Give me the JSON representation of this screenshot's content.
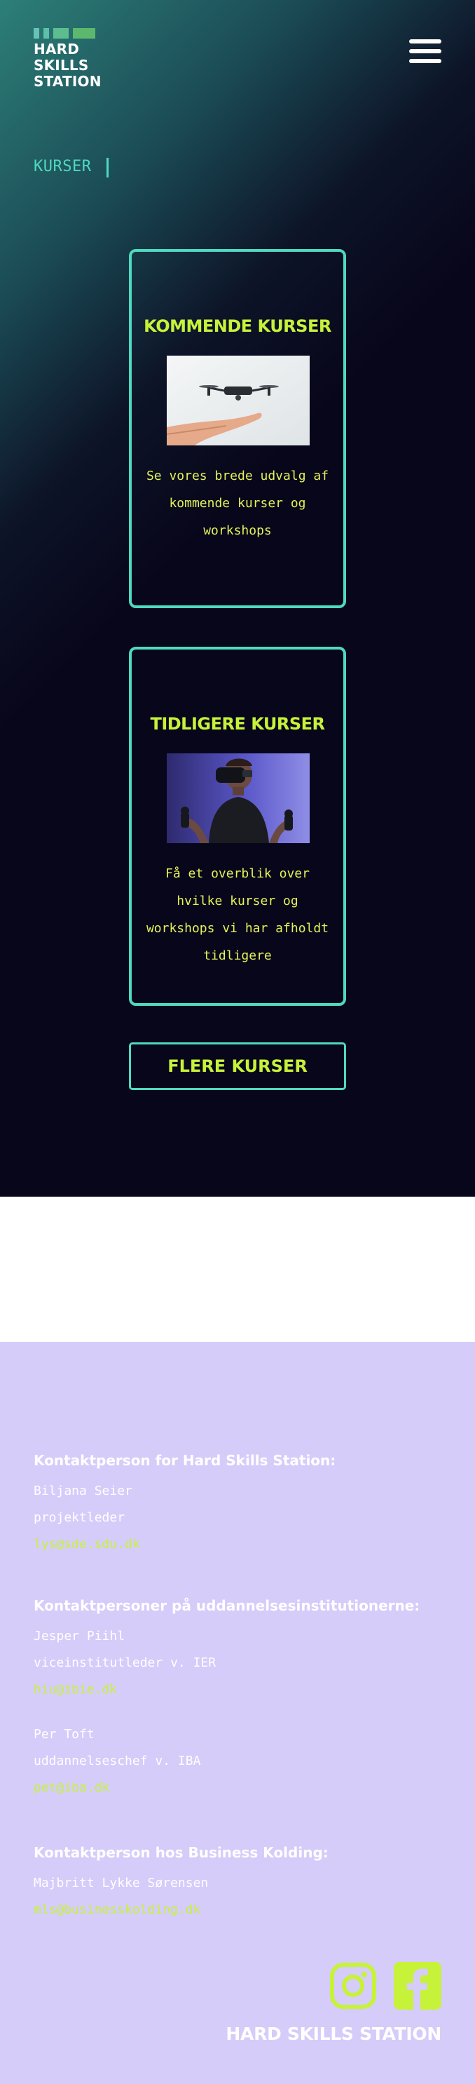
{
  "header": {
    "logo_lines": [
      "HARD",
      "SKILLS",
      "STATION"
    ],
    "menu_icon": "hamburger-menu-icon"
  },
  "page": {
    "title": "KURSER"
  },
  "cards": [
    {
      "title": "KOMMENDE KURSER",
      "image": "drone-hovering-over-hand-image",
      "description": "Se vores brede udvalg af kommende kurser og workshops"
    },
    {
      "title": "TIDLIGERE KURSER",
      "image": "man-wearing-vr-headset-image",
      "description": "Få et overblik over hvilke kurser og workshops vi har afholdt tidligere"
    }
  ],
  "more_button": {
    "label": "FLERE KURSER"
  },
  "footer": {
    "contact_hss": {
      "heading": "Kontaktperson for Hard Skills Station:",
      "name": "Biljana Seier",
      "role": "projektleder",
      "email": "lys@sde.sdu.dk"
    },
    "contact_institutions": {
      "heading": "Kontaktpersoner på uddannelsesinstitutionerne:",
      "people": [
        {
          "name": "Jesper Piihl",
          "role": "viceinstitutleder v. IER",
          "email": "hiu@ibie.dk"
        },
        {
          "name": "Per Toft",
          "role": "uddannelseschef v. IBA",
          "email": "pet@iba.dk"
        }
      ]
    },
    "contact_business": {
      "heading": "Kontaktperson hos Business Kolding:",
      "name": "Majbritt Lykke Sørensen",
      "email": "mls@businesskolding.dk"
    },
    "social_icons": [
      "instagram-icon",
      "facebook-icon"
    ],
    "brand": "HARD SKILLS STATION"
  },
  "colors": {
    "accent_teal": "#4fd9c0",
    "accent_lime": "#c7f23a",
    "footer_bg": "#d5ccfa",
    "hero_bg": "#08061a"
  }
}
